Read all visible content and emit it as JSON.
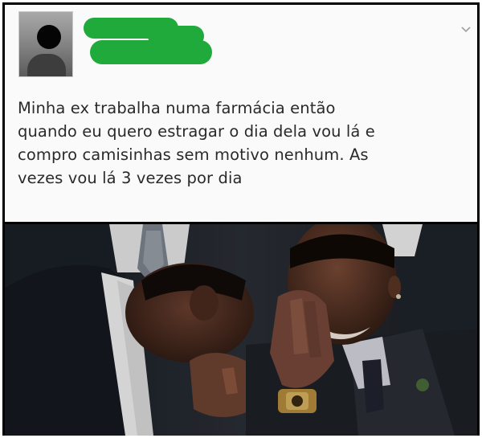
{
  "post": {
    "author_avatar": "profile-photo-blacked-out",
    "author_name_redacted": true,
    "menu_icon": "chevron-down-icon",
    "text": "Minha ex trabalha numa farmácia então\nquando eu quero estragar o dia dela vou lá e\ncompro camisinhas sem motivo nenhum. As\nvezes vou lá 3 vezes por dia"
  },
  "colors": {
    "redaction": "#1faa3b",
    "card_bg": "#fafafa",
    "text": "#2a2a2a",
    "frame": "#000000"
  },
  "image": {
    "subject": "two men in suits laughing"
  }
}
